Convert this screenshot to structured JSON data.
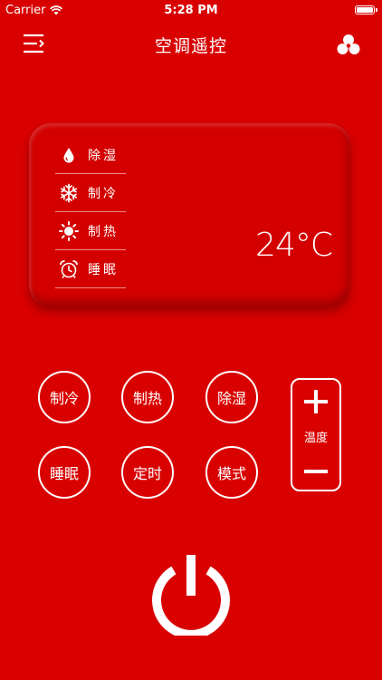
{
  "status_bar": {
    "carrier": "Carrier",
    "time": "5:28 PM"
  },
  "nav": {
    "title": "空调遥控",
    "menu_icon": "menu-icon",
    "share_icon": "circles-icon"
  },
  "display": {
    "modes": [
      {
        "icon": "droplet-icon",
        "label": "除湿"
      },
      {
        "icon": "snowflake-icon",
        "label": "制冷"
      },
      {
        "icon": "sun-icon",
        "label": "制热"
      },
      {
        "icon": "alarm-clock-icon",
        "label": "睡眠"
      }
    ],
    "temperature": "24°C"
  },
  "buttons": {
    "cool": "制冷",
    "heat": "制热",
    "dehumidify": "除湿",
    "sleep": "睡眠",
    "timer": "定时",
    "mode": "模式"
  },
  "temperature_control": {
    "label": "温度"
  },
  "colors": {
    "background": "#d90000",
    "foreground": "#ffffff"
  }
}
